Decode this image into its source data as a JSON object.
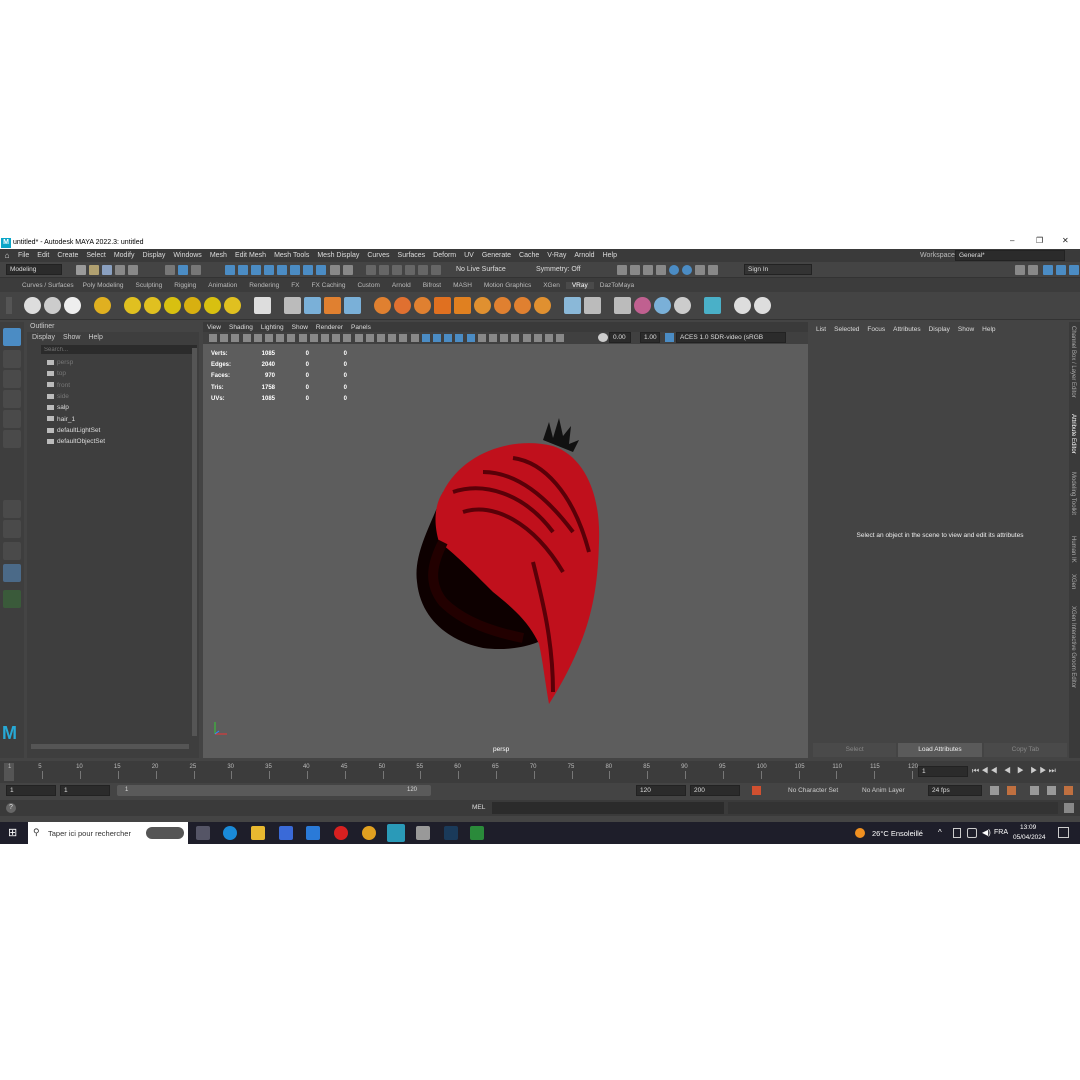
{
  "window": {
    "title": "untitled* - Autodesk MAYA 2022.3: untitled",
    "min": "–",
    "max": "❐",
    "close": "✕"
  },
  "menubar": {
    "items": [
      "File",
      "Edit",
      "Create",
      "Select",
      "Modify",
      "Display",
      "Windows",
      "Mesh",
      "Edit Mesh",
      "Mesh Tools",
      "Mesh Display",
      "Curves",
      "Surfaces",
      "Deform",
      "UV",
      "Generate",
      "Cache",
      "V-Ray",
      "Arnold",
      "Help"
    ],
    "workspace_label": "Workspace:",
    "workspace_value": "General*"
  },
  "statusline": {
    "mode": "Modeling",
    "live_surface": "No Live Surface",
    "symmetry": "Symmetry: Off",
    "sign_in": "Sign In"
  },
  "shelf_tabs": [
    "Curves / Surfaces",
    "Poly Modeling",
    "Sculpting",
    "Rigging",
    "Animation",
    "Rendering",
    "FX",
    "FX Caching",
    "Custom",
    "Arnold",
    "Bifrost",
    "MASH",
    "Motion Graphics",
    "XGen",
    "VRay",
    "DazToMaya"
  ],
  "shelf_active": "VRay",
  "outliner": {
    "title": "Outliner",
    "menu": [
      "Display",
      "Show",
      "Help"
    ],
    "search_placeholder": "Search...",
    "items": [
      {
        "label": "persp",
        "dim": true
      },
      {
        "label": "top",
        "dim": true
      },
      {
        "label": "front",
        "dim": true
      },
      {
        "label": "side",
        "dim": true
      },
      {
        "label": "salp",
        "dim": false
      },
      {
        "label": "hair_1",
        "dim": false
      },
      {
        "label": "defaultLightSet",
        "dim": false
      },
      {
        "label": "defaultObjectSet",
        "dim": false
      }
    ]
  },
  "viewport": {
    "menu": [
      "View",
      "Shading",
      "Lighting",
      "Show",
      "Renderer",
      "Panels"
    ],
    "exposure": "0.00",
    "gamma": "1.00",
    "colorspace": "ACES 1.0 SDR-video (sRGB",
    "camera": "persp",
    "hud": [
      {
        "label": "Verts:",
        "a": "1085",
        "b": "0",
        "c": "0"
      },
      {
        "label": "Edges:",
        "a": "2040",
        "b": "0",
        "c": "0"
      },
      {
        "label": "Faces:",
        "a": "970",
        "b": "0",
        "c": "0"
      },
      {
        "label": "Tris:",
        "a": "1758",
        "b": "0",
        "c": "0"
      },
      {
        "label": "UVs:",
        "a": "1085",
        "b": "0",
        "c": "0"
      }
    ],
    "hair_color": "#c0101c"
  },
  "attribute_editor": {
    "menu": [
      "List",
      "Selected",
      "Focus",
      "Attributes",
      "Display",
      "Show",
      "Help"
    ],
    "message": "Select an object in the scene to view and edit its attributes",
    "buttons": [
      "Select",
      "Load Attributes",
      "Copy Tab"
    ]
  },
  "right_tabs": [
    "Channel Box / Layer Editor",
    "Attribute Editor",
    "Modeling Toolkit",
    "Human IK",
    "XGen",
    "XGen Interactive Groom Editor"
  ],
  "timeslider": {
    "ticks": [
      "5",
      "10",
      "15",
      "20",
      "25",
      "30",
      "35",
      "40",
      "45",
      "50",
      "55",
      "60",
      "65",
      "70",
      "75",
      "80",
      "85",
      "90",
      "95",
      "100",
      "105",
      "110",
      "115",
      "120"
    ],
    "start": "1",
    "current_frame": "1"
  },
  "range": {
    "start": "1",
    "start2": "1",
    "bar_start": "1",
    "bar_end": "120",
    "end": "120",
    "end2": "200",
    "character_set": "No Character Set",
    "anim_layer": "No Anim Layer",
    "fps": "24 fps"
  },
  "cmdline": {
    "lang": "MEL"
  },
  "taskbar": {
    "search_placeholder": "Taper ici pour rechercher",
    "weather": "26°C  Ensoleillé",
    "lang": "FRA",
    "time": "13:09",
    "date": "05/04/2024"
  }
}
